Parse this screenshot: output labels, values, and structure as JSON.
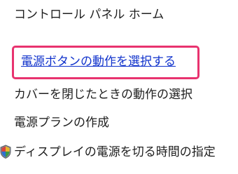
{
  "nav": {
    "home": "コントロール パネル ホーム",
    "power_buttons": "電源ボタンの動作を選択する",
    "lid_close": "カバーを閉じたときの動作の選択",
    "create_plan": "電源プランの作成",
    "display_off": "ディスプレイの電源を切る時間の指定"
  },
  "colors": {
    "highlight": "#e8336f",
    "link": "#1133cc",
    "text": "#1e1e1e"
  },
  "icons": {
    "display_off_icon": "shield-icon"
  }
}
